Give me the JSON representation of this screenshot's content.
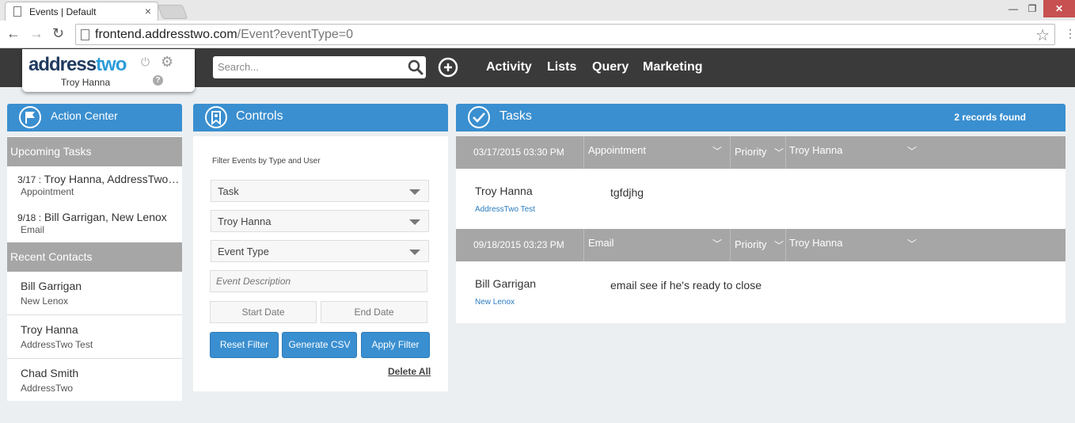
{
  "browser": {
    "tab_title": "Events | Default",
    "url_host": "frontend.addresstwo.com",
    "url_path": "/Event?eventType=0"
  },
  "header": {
    "logo_dark": "address",
    "logo_light": "two",
    "user": "Troy Hanna",
    "search_placeholder": "Search...",
    "nav": [
      "Activity",
      "Lists",
      "Query",
      "Marketing"
    ]
  },
  "action_center": {
    "title": "Action Center",
    "upcoming_title": "Upcoming Tasks",
    "upcoming": [
      {
        "date": "3/17 :",
        "who": "Troy Hanna, AddressTwo Test",
        "type": "Appointment"
      },
      {
        "date": "9/18 :",
        "who": "Bill Garrigan, New Lenox",
        "type": "Email"
      }
    ],
    "recent_title": "Recent Contacts",
    "recent": [
      {
        "name": "Bill Garrigan",
        "company": "New Lenox"
      },
      {
        "name": "Troy Hanna",
        "company": "AddressTwo Test"
      },
      {
        "name": "Chad Smith",
        "company": "AddressTwo"
      }
    ]
  },
  "controls": {
    "title": "Controls",
    "filter_title": "Filter Events by Type and User",
    "type_select": "Task",
    "user_select": "Troy Hanna",
    "event_type_select": "Event Type",
    "description_placeholder": "Event Description",
    "start_placeholder": "Start Date",
    "end_placeholder": "End Date",
    "reset_label": "Reset Filter",
    "csv_label": "Generate CSV",
    "apply_label": "Apply Filter",
    "delete_all_label": "Delete All"
  },
  "tasks": {
    "title": "Tasks",
    "count": "2 records found",
    "priority_label": "Priority",
    "items": [
      {
        "datetime": "03/17/2015 03:30 PM",
        "type": "Appointment",
        "assignee": "Troy Hanna",
        "contact": "Troy Hanna",
        "company": "AddressTwo Test",
        "description": "tgfdjhg"
      },
      {
        "datetime": "09/18/2015 03:23 PM",
        "type": "Email",
        "assignee": "Troy Hanna",
        "contact": "Bill Garrigan",
        "company": "New Lenox",
        "description": "email see if he's ready to close"
      }
    ]
  },
  "colors": {
    "accent": "#3a8fd0",
    "header": "#3a3a3a",
    "section_gray": "#a6a6a6",
    "logo_blue": "#2b9bd8"
  }
}
